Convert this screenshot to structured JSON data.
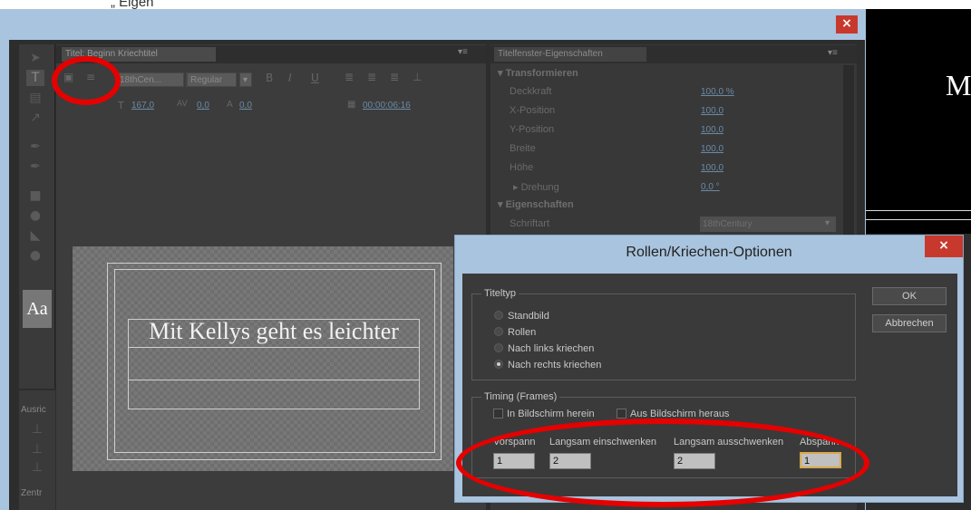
{
  "top_partial_text": "„ Eigen",
  "main_window": {
    "close_glyph": "×"
  },
  "title_panel": {
    "tab_label": "Titel: Beginn Kriechtitel",
    "menu_glyph": "▾≡",
    "font_family_value": "18thCen...",
    "font_style_value": "Regular",
    "font_size_value": "167,0",
    "kerning_value": "0,0",
    "leading_value": "0,0",
    "timecode": "00:00:06:16",
    "canvas_text": "Mit Kellys geht es leichter"
  },
  "properties_panel": {
    "tab_label": "Titelfenster-Eigenschaften",
    "menu_glyph": "▾≡",
    "sections": {
      "transform": "Transformieren",
      "properties": "Eigenschaften"
    },
    "rows": [
      {
        "label": "Deckkraft",
        "value": "100,0 %"
      },
      {
        "label": "X-Position",
        "value": "100,0"
      },
      {
        "label": "Y-Position",
        "value": "100,0"
      },
      {
        "label": "Breite",
        "value": "100,0"
      },
      {
        "label": "Höhe",
        "value": "100,0"
      },
      {
        "label": "▸  Drehung",
        "value": "0,0 °"
      }
    ],
    "font_label": "Schriftart",
    "font_value": "18thCentury"
  },
  "tool_panel": {
    "aa_label": "Aa",
    "ausrichten_label": "Ausric",
    "zentrieren_label": "Zentr"
  },
  "right_preview": {
    "letter": "M"
  },
  "dialog": {
    "title": "Rollen/Kriechen-Optionen",
    "close_glyph": "×",
    "title_type_group": "Titeltyp",
    "options": [
      {
        "label": "Standbild",
        "selected": false
      },
      {
        "label": "Rollen",
        "selected": false
      },
      {
        "label": "Nach links kriechen",
        "selected": false
      },
      {
        "label": "Nach rechts kriechen",
        "selected": true
      }
    ],
    "timing_group": "Timing (Frames)",
    "checkbox_in": "In Bildschirm herein",
    "checkbox_out": "Aus Bildschirm heraus",
    "fields": [
      {
        "label": "Vorspann",
        "value": "1"
      },
      {
        "label": "Langsam einschwenken",
        "value": "2"
      },
      {
        "label": "Langsam ausschwenken",
        "value": "2"
      },
      {
        "label": "Abspann",
        "value": "1"
      }
    ],
    "ok_label": "OK",
    "cancel_label": "Abbrechen"
  },
  "colors": {
    "accent_red": "#e60000",
    "dialog_frame": "#a9c4de",
    "close_red": "#c7392d"
  }
}
